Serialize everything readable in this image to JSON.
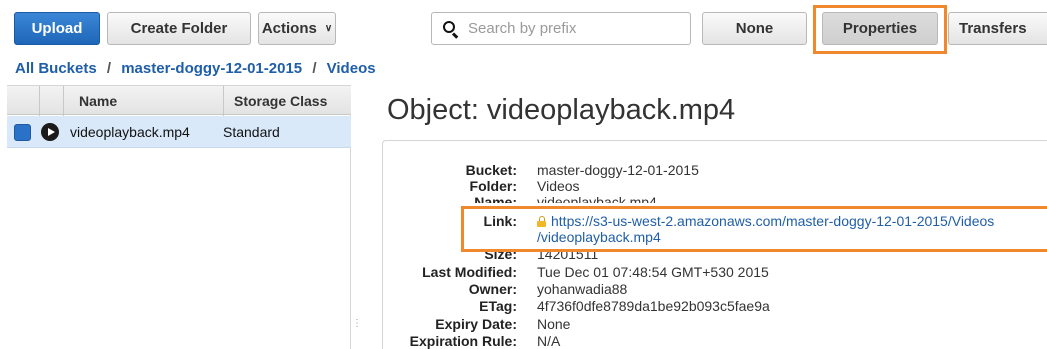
{
  "toolbar": {
    "upload_label": "Upload",
    "create_folder_label": "Create Folder",
    "actions_label": "Actions",
    "search_placeholder": "Search by prefix",
    "none_label": "None",
    "properties_label": "Properties",
    "transfers_label": "Transfers"
  },
  "breadcrumb": {
    "items": [
      "All Buckets",
      "master-doggy-12-01-2015",
      "Videos"
    ],
    "separator": "/"
  },
  "table": {
    "headers": {
      "name": "Name",
      "storage_class": "Storage Class"
    },
    "rows": [
      {
        "name": "videoplayback.mp4",
        "storage_class": "Standard",
        "selected": true
      }
    ]
  },
  "details": {
    "title": "Object: videoplayback.mp4",
    "properties": {
      "bucket": {
        "label": "Bucket:",
        "value": "master-doggy-12-01-2015"
      },
      "folder": {
        "label": "Folder:",
        "value": "Videos"
      },
      "name": {
        "label": "Name:",
        "value": "videoplayback.mp4"
      },
      "link": {
        "label": "Link:",
        "line1": "https://s3-us-west-2.amazonaws.com/master-doggy-12-01-2015/Videos",
        "line2": "/videoplayback.mp4"
      },
      "size": {
        "label": "Size:",
        "value": "14201511"
      },
      "last_modified": {
        "label": "Last Modified:",
        "value": "Tue Dec 01 07:48:54 GMT+530 2015"
      },
      "owner": {
        "label": "Owner:",
        "value": "yohanwadia88"
      },
      "etag": {
        "label": "ETag:",
        "value": "4f736f0dfe8789da1be92b093c5fae9a"
      },
      "expiry_date": {
        "label": "Expiry Date:",
        "value": "None"
      },
      "expiration_rule": {
        "label": "Expiration Rule:",
        "value": "N/A"
      }
    }
  },
  "colors": {
    "accent_blue": "#1f66b8",
    "link_blue": "#1f5ea8",
    "highlight_orange": "#f0882e",
    "selected_row": "#d9e9f9"
  }
}
